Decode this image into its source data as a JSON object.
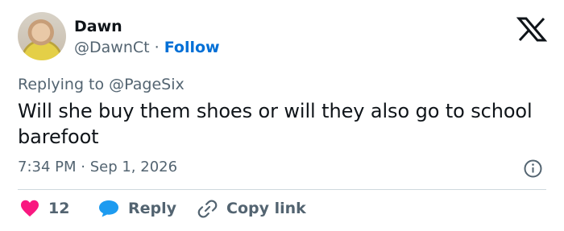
{
  "author": {
    "display_name": "Dawn",
    "handle": "@DawnCt",
    "separator": "·",
    "follow_label": "Follow"
  },
  "reply_context": {
    "text": "Replying to @PageSix"
  },
  "tweet": {
    "text": "Will she buy them shoes or will they also go to school barefoot",
    "time": "7:34 PM · Sep 1, 2026"
  },
  "actions": {
    "like_count": "12",
    "reply_label": "Reply",
    "copy_link_label": "Copy link"
  },
  "icons": {
    "brand": "x-logo-icon",
    "info": "info-icon",
    "like": "heart-icon",
    "reply": "speech-bubble-icon",
    "copy": "link-icon"
  },
  "colors": {
    "follow_link": "#006fd6",
    "like": "#f91880",
    "reply": "#1d9bf0",
    "secondary_text": "#536471",
    "divider": "#cfd9de"
  }
}
